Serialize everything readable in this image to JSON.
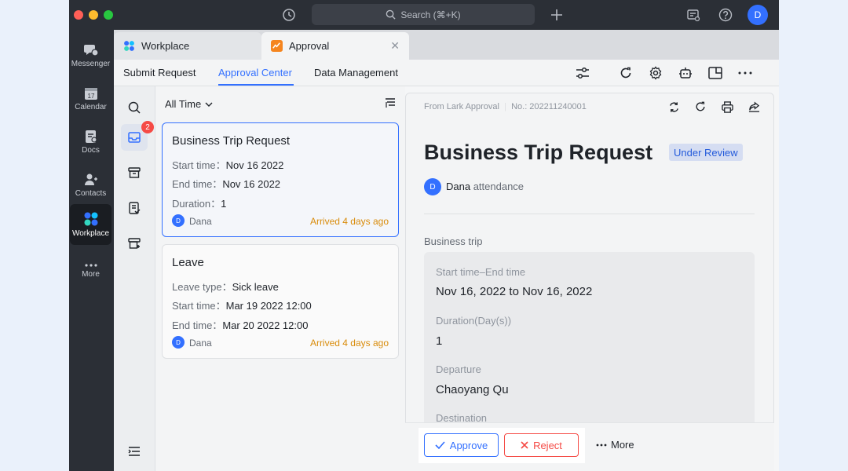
{
  "titlebar": {
    "search_label": "Search (⌘+K)",
    "avatar_initial": "D"
  },
  "leftnav": {
    "items": [
      {
        "label": "Messenger",
        "icon": "messenger-icon"
      },
      {
        "label": "Calendar",
        "icon": "calendar-icon",
        "badge_day": "17"
      },
      {
        "label": "Docs",
        "icon": "docs-icon"
      },
      {
        "label": "Contacts",
        "icon": "contacts-icon"
      },
      {
        "label": "Workplace",
        "icon": "workplace-icon",
        "active": true
      },
      {
        "label": "More",
        "icon": "more-icon"
      }
    ]
  },
  "tabs": [
    {
      "label": "Workplace",
      "icon": "workplace-icon"
    },
    {
      "label": "Approval",
      "icon": "approval-icon"
    }
  ],
  "subnav": {
    "items": [
      "Submit Request",
      "Approval Center",
      "Data Management"
    ],
    "active": "Approval Center"
  },
  "sidebar": {
    "badge_count": "2"
  },
  "list": {
    "filter_label": "All Time",
    "cards": [
      {
        "title": "Business Trip Request",
        "fields": [
          {
            "label": "Start time：",
            "value": "Nov 16 2022"
          },
          {
            "label": "End time：",
            "value": "Nov 16 2022"
          },
          {
            "label": "Duration：",
            "value": "1"
          }
        ],
        "user_initial": "D",
        "user": "Dana",
        "arrived": "Arrived 4 days ago"
      },
      {
        "title": "Leave",
        "fields": [
          {
            "label": "Leave type：",
            "value": "Sick leave"
          },
          {
            "label": "Start time：",
            "value": "Mar 19 2022 12:00"
          },
          {
            "label": "End time：",
            "value": "Mar 20 2022 12:00"
          }
        ],
        "user_initial": "D",
        "user": "Dana",
        "arrived": "Arrived 4 days ago"
      }
    ]
  },
  "detail": {
    "source": "From Lark Approval",
    "number": "No.: 202211240001",
    "title": "Business Trip Request",
    "status": "Under Review",
    "requester_initial": "D",
    "requester": "Dana",
    "requester_sub": "attendance",
    "section": "Business trip",
    "fields": [
      {
        "label": "Start time–End time",
        "value": "Nov 16, 2022 to Nov 16, 2022"
      },
      {
        "label": "Duration(Day(s))",
        "value": "1"
      },
      {
        "label": "Departure",
        "value": "Chaoyang Qu"
      },
      {
        "label": "Destination",
        "value": ""
      }
    ]
  },
  "actions": {
    "approve": "Approve",
    "reject": "Reject",
    "more": "More"
  },
  "colors": {
    "accent": "#3370ff",
    "danger": "#f54a45",
    "warning": "#d98c0b"
  }
}
